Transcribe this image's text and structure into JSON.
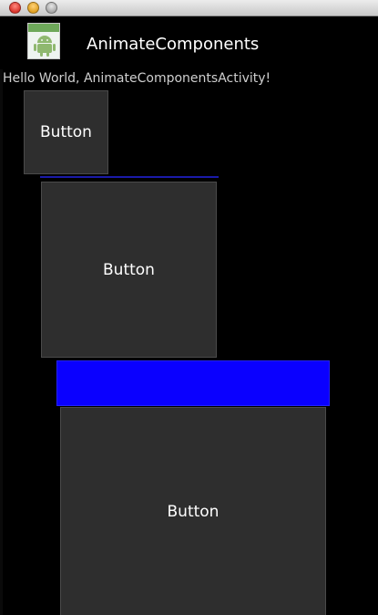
{
  "app": {
    "title": "AnimateComponents",
    "icon": "android-app-icon"
  },
  "main": {
    "hello_text": "Hello World, AnimateComponentsActivity!",
    "buttons": [
      {
        "label": "Button"
      },
      {
        "label": "Button"
      },
      {
        "label": "Button"
      }
    ],
    "colors": {
      "background": "#000000",
      "button_bg": "#2e2e2e",
      "blue_block": "#0a00ff",
      "divider": "#1a1aa8"
    }
  }
}
